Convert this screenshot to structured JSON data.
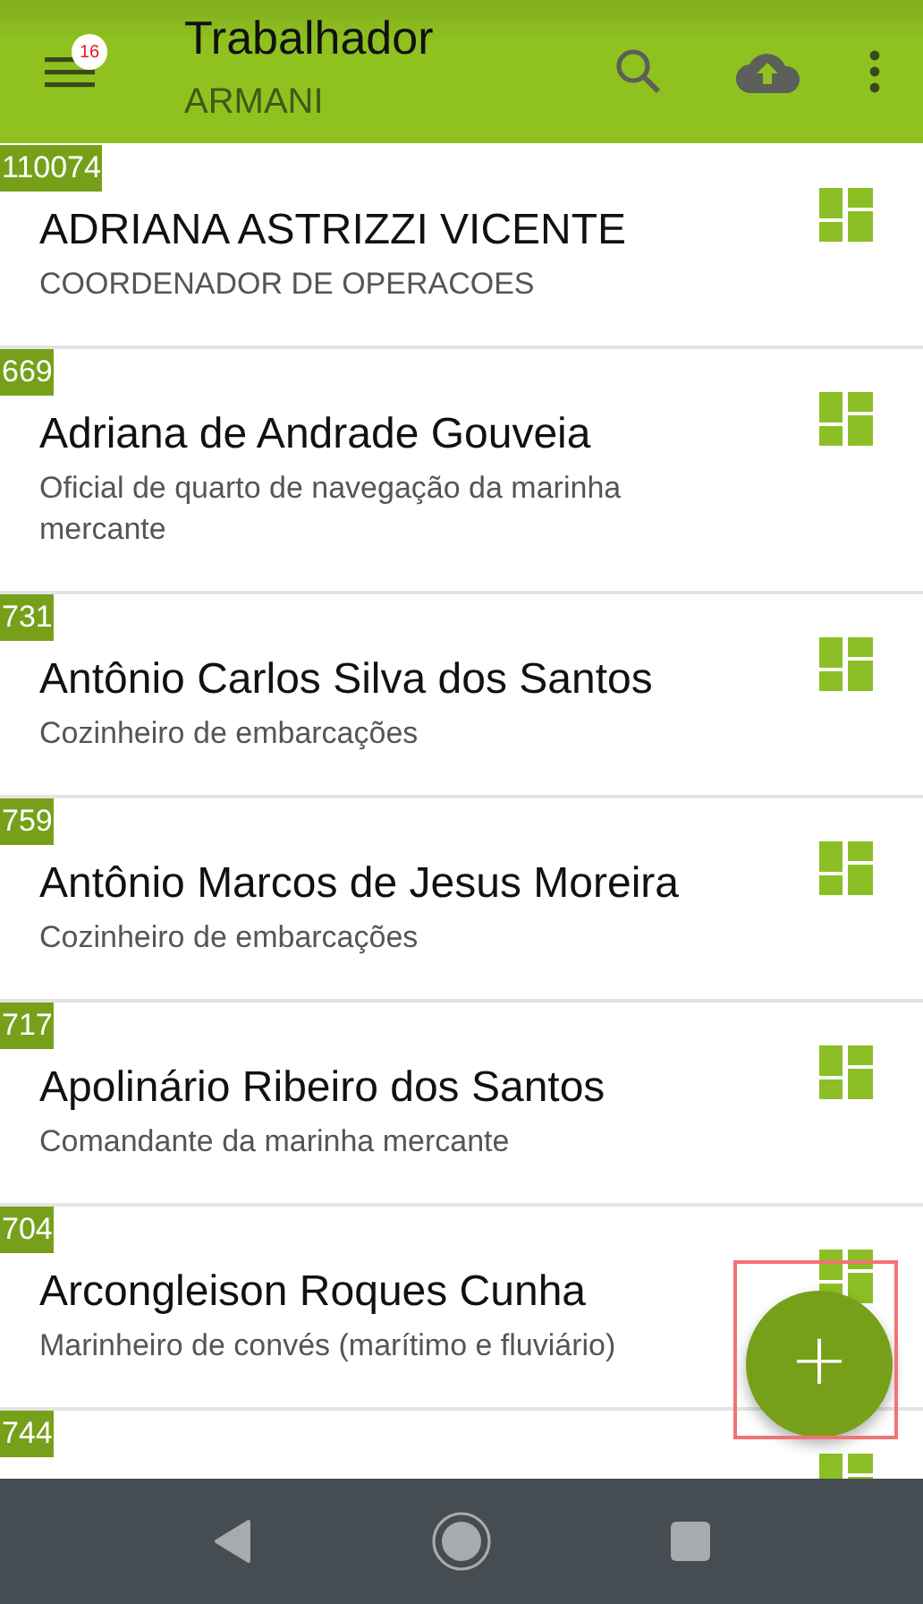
{
  "app_bar": {
    "title": "Trabalhador",
    "subtitle": "ARMANI",
    "menu_badge": "16"
  },
  "workers": [
    {
      "code": "110074",
      "name": "ADRIANA ASTRIZZI VICENTE",
      "role": "COORDENADOR DE OPERACOES"
    },
    {
      "code": "669",
      "name": "Adriana de Andrade Gouveia",
      "role": "Oficial de quarto de navegação da marinha mercante"
    },
    {
      "code": "731",
      "name": "Antônio Carlos Silva dos Santos",
      "role": "Cozinheiro de embarcações"
    },
    {
      "code": "759",
      "name": "Antônio Marcos de Jesus Moreira",
      "role": "Cozinheiro de embarcações"
    },
    {
      "code": "717",
      "name": "Apolinário Ribeiro dos Santos",
      "role": "Comandante da marinha mercante"
    },
    {
      "code": "704",
      "name": "Arcongleison Roques Cunha",
      "role": "Marinheiro de convés (marítimo e fluviário)"
    },
    {
      "code": "744"
    }
  ],
  "fab": {
    "label": "+",
    "highlighted": true
  }
}
